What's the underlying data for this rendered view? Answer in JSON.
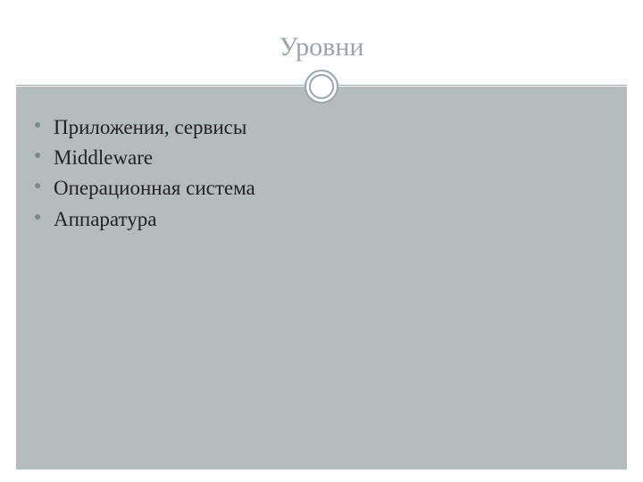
{
  "slide": {
    "title": "Уровни",
    "bullets": [
      {
        "text": "Приложения, сервисы"
      },
      {
        "text": "Middleware"
      },
      {
        "text": "Операционная система"
      },
      {
        "text": "Аппаратура"
      }
    ]
  },
  "colors": {
    "title": "#9aa6a9",
    "content_bg": "#b4bcbc",
    "bullet_marker": "#7a8a8a",
    "text": "#222222"
  }
}
